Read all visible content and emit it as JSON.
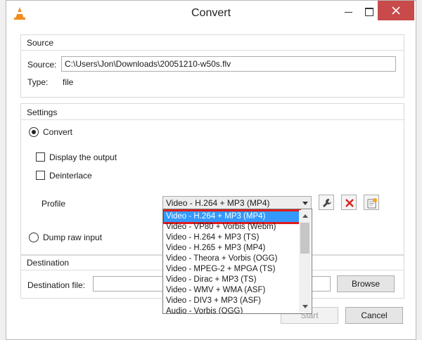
{
  "window": {
    "title": "Convert",
    "icon": "vlc-cone-icon"
  },
  "source": {
    "group_label": "Source",
    "source_label": "Source:",
    "source_value": "C:\\Users\\Jon\\Downloads\\20051210-w50s.flv",
    "type_label": "Type:",
    "type_value": "file"
  },
  "settings": {
    "group_label": "Settings",
    "convert_label": "Convert",
    "convert_selected": true,
    "display_output_label": "Display the output",
    "deinterlace_label": "Deinterlace",
    "profile_label": "Profile",
    "profile_value": "Video - H.264 + MP3 (MP4)",
    "dump_raw_label": "Dump raw input",
    "profile_icons": [
      "wrench-icon",
      "delete-icon",
      "new-profile-icon"
    ],
    "profile_options": [
      "Video - H.264 + MP3 (MP4)",
      "Video - VP80 + Vorbis (Webm)",
      "Video - H.264 + MP3 (TS)",
      "Video - H.265 + MP3 (MP4)",
      "Video - Theora + Vorbis (OGG)",
      "Video - MPEG-2 + MPGA (TS)",
      "Video - Dirac + MP3 (TS)",
      "Video - WMV + WMA (ASF)",
      "Video - DIV3 + MP3 (ASF)",
      "Audio - Vorbis (OGG)"
    ]
  },
  "destination": {
    "group_label": "Destination",
    "file_label": "Destination file:",
    "file_value": "",
    "browse_label": "Browse"
  },
  "footer": {
    "start_label": "Start",
    "cancel_label": "Cancel"
  },
  "colors": {
    "selection": "#3399ff",
    "highlight_box": "#e11b1b",
    "close_button": "#c84a4a"
  }
}
